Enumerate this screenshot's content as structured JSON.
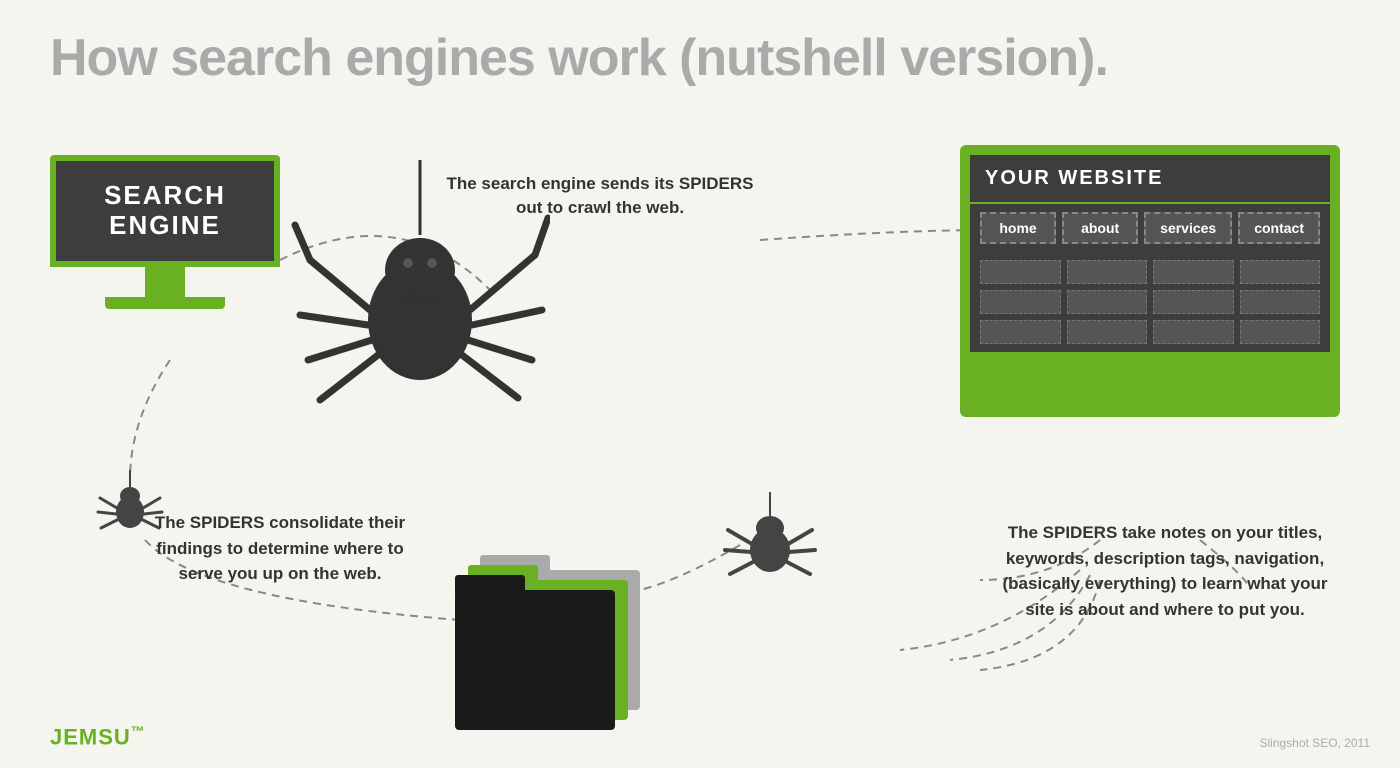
{
  "title": "How search engines work (nutshell version).",
  "search_engine_label": "SEARCH ENGINE",
  "website_label": "YOUR WEBSITE",
  "nav_items": [
    "home",
    "about",
    "services",
    "contact"
  ],
  "annotation_top": "The search engine sends its SPIDERS out to crawl the web.",
  "annotation_bottom_left": "The SPIDERS consolidate their findings to determine where to serve you up on the web.",
  "annotation_bottom_right": "The SPIDERS take notes on your titles, keywords, description tags, navigation, (basically everything) to learn what your site is about and where to put you.",
  "logo": "JEMSU",
  "logo_tm": "™",
  "attribution": "Slingshot SEO, 2011"
}
